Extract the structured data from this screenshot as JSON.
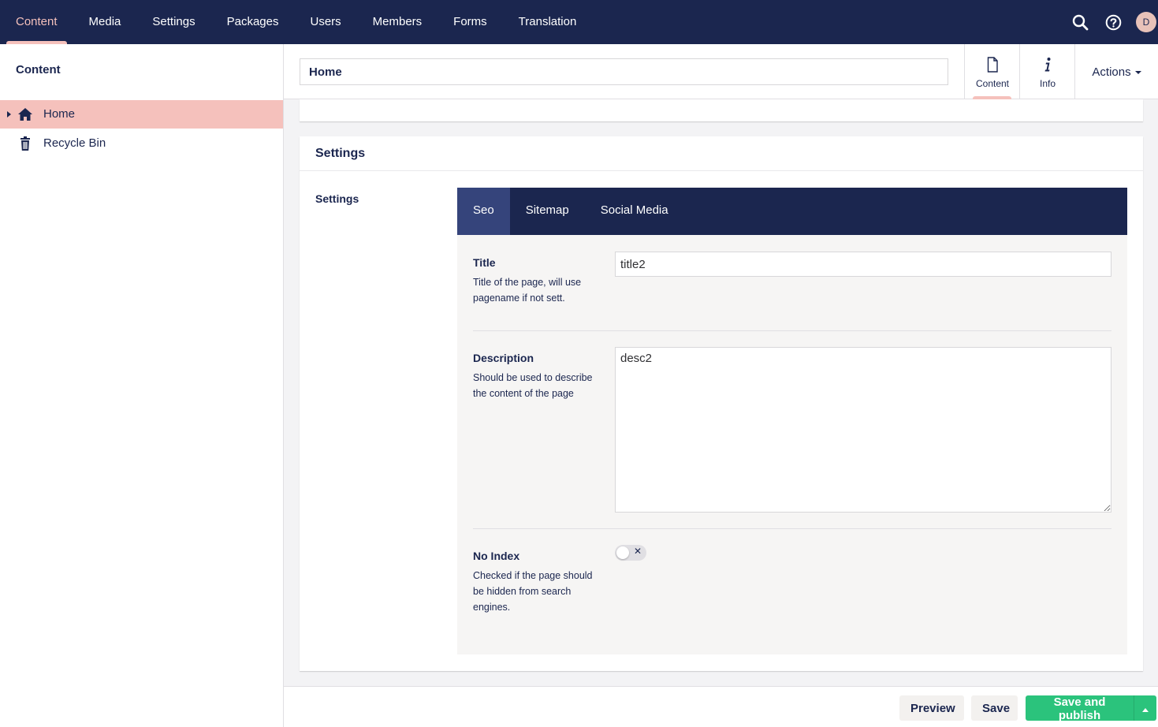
{
  "topnav": {
    "items": [
      {
        "label": "Content",
        "active": true
      },
      {
        "label": "Media"
      },
      {
        "label": "Settings"
      },
      {
        "label": "Packages"
      },
      {
        "label": "Users"
      },
      {
        "label": "Members"
      },
      {
        "label": "Forms"
      },
      {
        "label": "Translation"
      }
    ],
    "icons": [
      "search-icon",
      "help-icon"
    ],
    "avatar_initial": "D"
  },
  "sidebar": {
    "title": "Content",
    "tree": [
      {
        "label": "Home",
        "icon": "home-icon",
        "selected": true
      },
      {
        "label": "Recycle Bin",
        "icon": "trash-icon"
      }
    ]
  },
  "editor": {
    "node_name": "Home",
    "apps": [
      {
        "label": "Content",
        "icon": "document-icon",
        "active": true
      },
      {
        "label": "Info",
        "icon": "info-icon"
      }
    ],
    "actions_label": "Actions"
  },
  "group": {
    "title": "Settings",
    "property_label": "Settings",
    "tabs": [
      {
        "label": "Seo",
        "active": true
      },
      {
        "label": "Sitemap"
      },
      {
        "label": "Social Media"
      }
    ],
    "fields": {
      "title": {
        "label": "Title",
        "description": "Title of the page, will use pagename if not sett.",
        "value": "title2"
      },
      "description": {
        "label": "Description",
        "description": "Should be used to describe the content of the page",
        "value": "desc2"
      },
      "noindex": {
        "label": "No Index",
        "description": "Checked if the page should be hidden from search engines.",
        "checked": false,
        "toggle_symbol": "✕"
      }
    }
  },
  "footer": {
    "preview_label": "Preview",
    "save_label": "Save",
    "publish_label": "Save and publish"
  },
  "colors": {
    "navy": "#1b264f",
    "pink": "#f5c1bc",
    "green": "#2bc37c",
    "active_tab": "#35447b"
  }
}
